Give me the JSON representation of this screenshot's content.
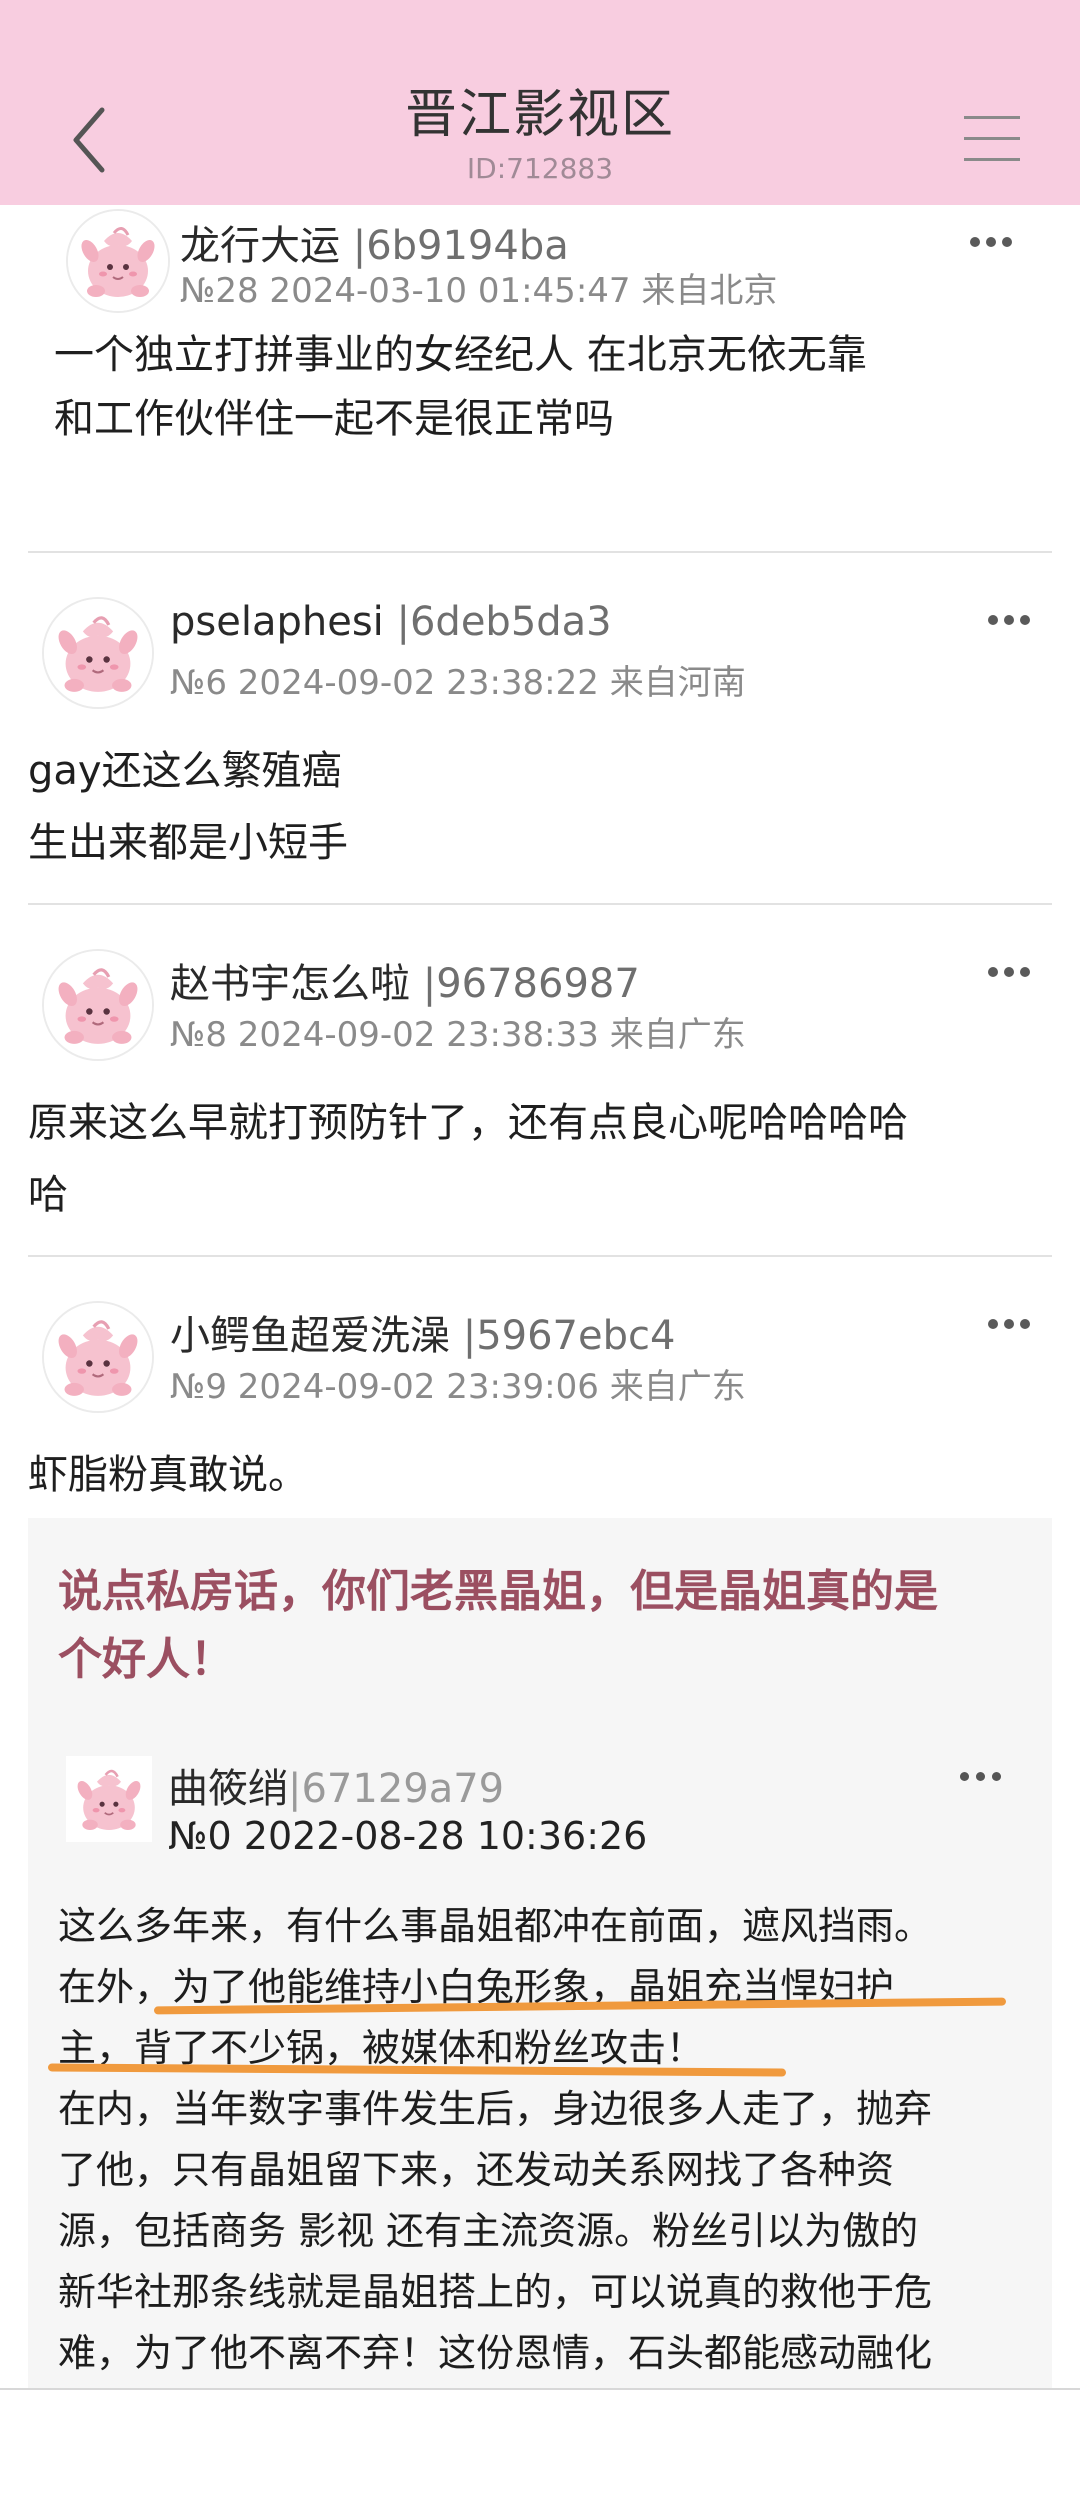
{
  "header": {
    "title": "晋江影视区",
    "subtitle": "ID:712883",
    "back_icon": "chevron-left-icon",
    "menu_icon": "hamburger-menu-icon",
    "background": "#f8cde0"
  },
  "posts": [
    {
      "username": "龙行大运",
      "uid": " |6b9194ba",
      "meta": "№28 2024-03-10 01:45:47 来自北京",
      "content_lines": [
        "一个独立打拼事业的女经纪人 在北京无依无靠",
        "和工作伙伴住一起不是很正常吗"
      ]
    },
    {
      "username": "pselaphesi",
      "uid": " |6deb5da3",
      "meta": "№6 2024-09-02 23:38:22 来自河南",
      "content_lines": [
        "gay还这么繁殖癌",
        "生出来都是小短手"
      ]
    },
    {
      "username": "赵书宇怎么啦",
      "uid": " |96786987",
      "meta": "№8 2024-09-02 23:38:33 来自广东",
      "content_lines": [
        "原来这么早就打预防针了，还有点良心呢哈哈哈哈",
        "哈"
      ]
    },
    {
      "username": "小鳄鱼超爱洗澡",
      "uid": " |5967ebc4",
      "meta": "№9 2024-09-02 23:39:06 来自广东",
      "content_lines": [
        "虾脂粉真敢说。"
      ]
    }
  ],
  "quote": {
    "headline_lines": [
      "说点私房话，你们老黑晶姐，但是晶姐真的是",
      "个好人！"
    ],
    "username": "曲筱绡",
    "uid": "|67129a79",
    "meta": "№0  2022-08-28 10:36:26",
    "text_lines": [
      "这么多年来，有什么事晶姐都冲在前面，遮风挡雨。",
      "在外，为了他能维持小白兔形象，晶姐充当悍妇护",
      "主，背了不少锅，被媒体和粉丝攻击！",
      "在内，当年数字事件发生后，身边很多人走了，抛弃",
      "了他，只有晶姐留下来，还发动关系网找了各种资",
      "源，包括商务 影视 还有主流资源。粉丝引以为傲的",
      "新华社那条线就是晶姐搭上的，可以说真的救他于危",
      "难，为了他不离不弃！这份恩情，石头都能感动融化"
    ],
    "headline_color": "#9b4f61",
    "underline_color": "#f09a3e"
  },
  "avatar_icon": "pink-balloon-creature-avatar-icon",
  "more_icon": "more-dots-icon"
}
